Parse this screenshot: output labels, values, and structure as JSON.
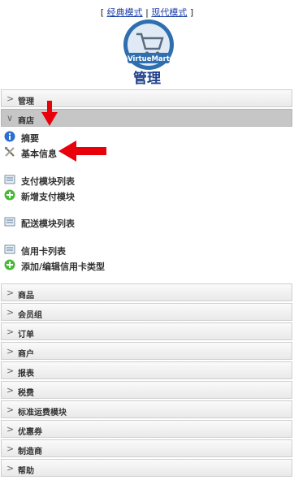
{
  "header": {
    "mode_open": "[",
    "mode_classic": "经典模式",
    "mode_sep": "|",
    "mode_modern": "现代模式",
    "mode_close": "]",
    "logo_text": "VirtueMart",
    "title": "管理"
  },
  "sections": {
    "admin": "管理",
    "store": "商店",
    "products": "商品",
    "groups": "会员组",
    "orders": "订单",
    "vendors": "商户",
    "reports": "报表",
    "tax": "税费",
    "shipping": "标准运费模块",
    "coupons": "优惠券",
    "manufacturers": "制造商",
    "help": "帮助"
  },
  "store_items": {
    "summary": "摘要",
    "basic_info": "基本信息",
    "payment_list": "支付模块列表",
    "add_payment": "新增支付模块",
    "shipping_list": "配送模块列表",
    "credit_list": "信用卡列表",
    "add_credit": "添加/编辑信用卡类型"
  },
  "colors": {
    "arrow": "#e8000b",
    "title": "#1d3f8a",
    "link": "#1a3ea8"
  },
  "icons": {
    "summary": "info-icon",
    "basic_info": "tools-icon",
    "payment_list": "list-icon",
    "add_payment": "plus-icon",
    "shipping_list": "list-icon",
    "credit_list": "list-icon",
    "add_credit": "plus-icon"
  }
}
